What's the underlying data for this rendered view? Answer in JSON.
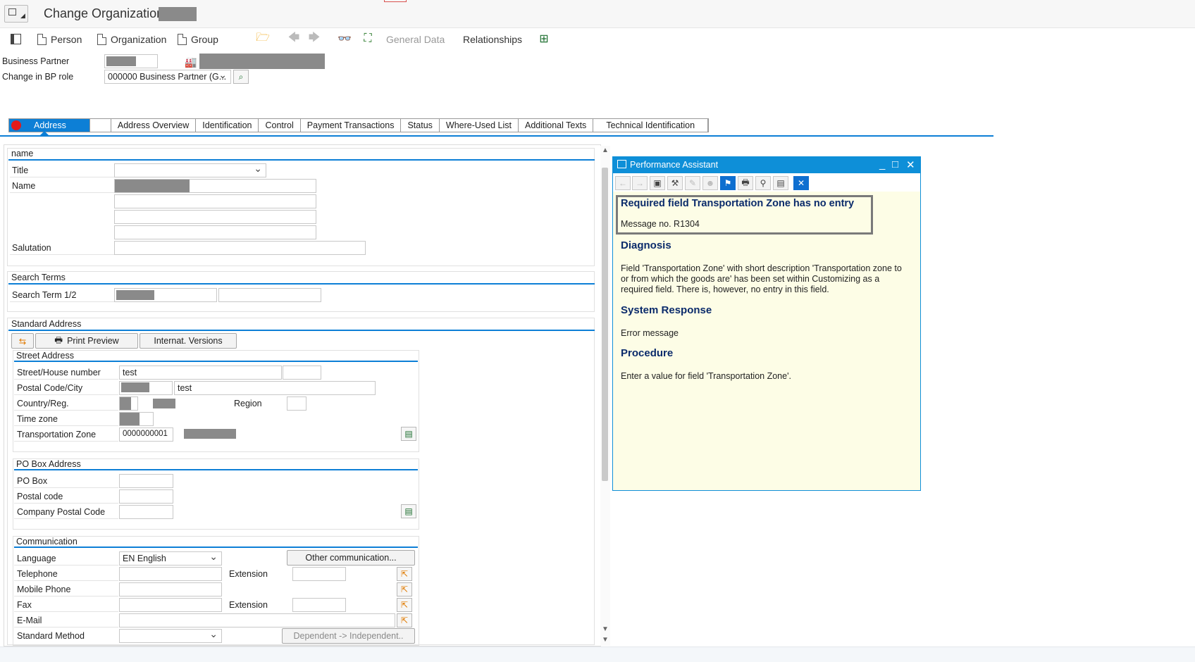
{
  "title": {
    "text": "Change Organization:"
  },
  "toolbar": {
    "person": "Person",
    "organization": "Organization",
    "group": "Group",
    "general_data": "General Data",
    "relationships": "Relationships"
  },
  "header": {
    "bp_label": "Business Partner",
    "role_label": "Change in BP role",
    "role_value": "000000 Business Partner (G..."
  },
  "tabs": [
    "Address",
    "",
    "Address Overview",
    "Identification",
    "Control",
    "Payment Transactions",
    "Status",
    "Where-Used List",
    "Additional Texts",
    "Technical Identification"
  ],
  "name_section": {
    "title": "name",
    "title_label": "Title",
    "name_label": "Name",
    "salutation_label": "Salutation"
  },
  "search_terms": {
    "title": "Search Terms",
    "label": "Search Term 1/2"
  },
  "standard_address": {
    "title": "Standard Address",
    "print_preview": "Print Preview",
    "internat_versions": "Internat. Versions",
    "street_section": "Street Address",
    "street_label": "Street/House number",
    "street_value": "test",
    "postal_label": "Postal Code/City",
    "city_value": "test",
    "country_label": "Country/Reg.",
    "region_label": "Region",
    "timezone_label": "Time zone",
    "transport_label": "Transportation Zone",
    "transport_value": "0000000001"
  },
  "po_box": {
    "title": "PO Box Address",
    "po_box_label": "PO Box",
    "postal_code_label": "Postal code",
    "company_postal_label": "Company Postal Code"
  },
  "communication": {
    "title": "Communication",
    "language_label": "Language",
    "language_value": "EN English",
    "other_button": "Other communication...",
    "telephone_label": "Telephone",
    "extension_label": "Extension",
    "mobile_label": "Mobile Phone",
    "fax_label": "Fax",
    "fax_extension_label": "Extension",
    "email_label": "E-Mail",
    "standard_method_label": "Standard Method",
    "dependent_button": "Dependent -> Independent.."
  },
  "performance_assistant": {
    "window_title": "Performance Assistant",
    "message_title": "Required field Transportation Zone has no entry",
    "message_no": "Message no. R1304",
    "diagnosis_heading": "Diagnosis",
    "diagnosis_text_1": "Field 'Transportation Zone' with short description 'Transportation zone to",
    "diagnosis_text_2": "or from which the goods are' has been set within Customizing as a",
    "diagnosis_text_3": "required field. There is, however, no entry in this field.",
    "system_response_heading": "System Response",
    "system_response_text": "Error message",
    "procedure_heading": "Procedure",
    "procedure_text": "Enter a value for field 'Transportation Zone'."
  },
  "colors": {
    "accent": "#0d7fd6",
    "pa_background": "#fdfde6",
    "error_dot": "#e21a1a"
  },
  "icons": [
    "menu-icon",
    "toggle-panel-icon",
    "document-icon",
    "folder-icon",
    "back-arrow-icon",
    "forward-arrow-icon",
    "glasses-icon",
    "hierarchy-icon",
    "org-chart-icon",
    "factory-icon",
    "search-help-icon",
    "printer-icon",
    "close-icon"
  ]
}
